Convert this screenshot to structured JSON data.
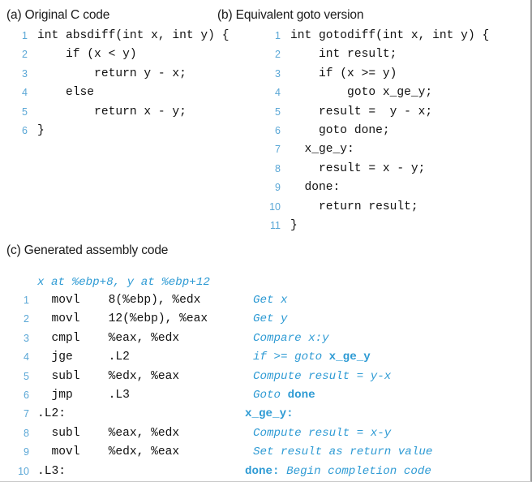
{
  "figure": {
    "panels": [
      {
        "id": "a",
        "heading": "(a) Original C code",
        "lines": [
          {
            "n": "1",
            "code": "int absdiff(int x, int y) {"
          },
          {
            "n": "2",
            "code": "    if (x < y)"
          },
          {
            "n": "3",
            "code": "        return y - x;"
          },
          {
            "n": "4",
            "code": "    else"
          },
          {
            "n": "5",
            "code": "        return x - y;"
          },
          {
            "n": "6",
            "code": "}"
          }
        ]
      },
      {
        "id": "b",
        "heading": "(b) Equivalent goto version",
        "lines": [
          {
            "n": "1",
            "code": "int gotodiff(int x, int y) {"
          },
          {
            "n": "2",
            "code": "    int result;"
          },
          {
            "n": "3",
            "code": "    if (x >= y)"
          },
          {
            "n": "4",
            "code": "        goto x_ge_y;"
          },
          {
            "n": "5",
            "code": "    result =  y - x;"
          },
          {
            "n": "6",
            "code": "    goto done;"
          },
          {
            "n": "7",
            "code": "  x_ge_y:"
          },
          {
            "n": "8",
            "code": "    result = x - y;"
          },
          {
            "n": "9",
            "code": "  done:"
          },
          {
            "n": "10",
            "code": "    return result;"
          },
          {
            "n": "11",
            "code": "}"
          }
        ]
      },
      {
        "id": "c",
        "heading": "(c) Generated assembly code",
        "annotation": "x at %ebp+8, y at %ebp+12",
        "lines": [
          {
            "n": "1",
            "code": "  movl    8(%ebp), %edx",
            "comment": [
              {
                "text": "Get x",
                "style": "italic"
              }
            ]
          },
          {
            "n": "2",
            "code": "  movl    12(%ebp), %eax",
            "comment": [
              {
                "text": "Get y",
                "style": "italic"
              }
            ]
          },
          {
            "n": "3",
            "code": "  cmpl    %eax, %edx",
            "comment": [
              {
                "text": "Compare x:y",
                "style": "italic"
              }
            ]
          },
          {
            "n": "4",
            "code": "  jge     .L2",
            "comment": [
              {
                "text": "if >= goto ",
                "style": "italic"
              },
              {
                "text": "x_ge_y",
                "style": "bold"
              }
            ]
          },
          {
            "n": "5",
            "code": "  subl    %edx, %eax",
            "comment": [
              {
                "text": "Compute result = y-x",
                "style": "italic"
              }
            ]
          },
          {
            "n": "6",
            "code": "  jmp     .L3",
            "comment": [
              {
                "text": "Goto ",
                "style": "italic"
              },
              {
                "text": "done",
                "style": "bold"
              }
            ]
          },
          {
            "n": "7",
            "code": ".L2:",
            "outdent": true,
            "comment": [
              {
                "text": "x_ge_y:",
                "style": "bold"
              }
            ]
          },
          {
            "n": "8",
            "code": "  subl    %eax, %edx",
            "comment": [
              {
                "text": "Compute result = x-y",
                "style": "italic"
              }
            ]
          },
          {
            "n": "9",
            "code": "  movl    %edx, %eax",
            "comment": [
              {
                "text": "Set result as return value",
                "style": "italic"
              }
            ]
          },
          {
            "n": "10",
            "code": ".L3:",
            "outdent": true,
            "comment": [
              {
                "text": "done: ",
                "style": "bold"
              },
              {
                "text": "Begin completion code",
                "style": "italic"
              }
            ]
          }
        ]
      }
    ],
    "colors": {
      "line_number": "#5aa7d6",
      "comment": "#2f9bd4",
      "code": "#111111",
      "heading": "#1a1a1a",
      "background": "#ffffff"
    }
  }
}
